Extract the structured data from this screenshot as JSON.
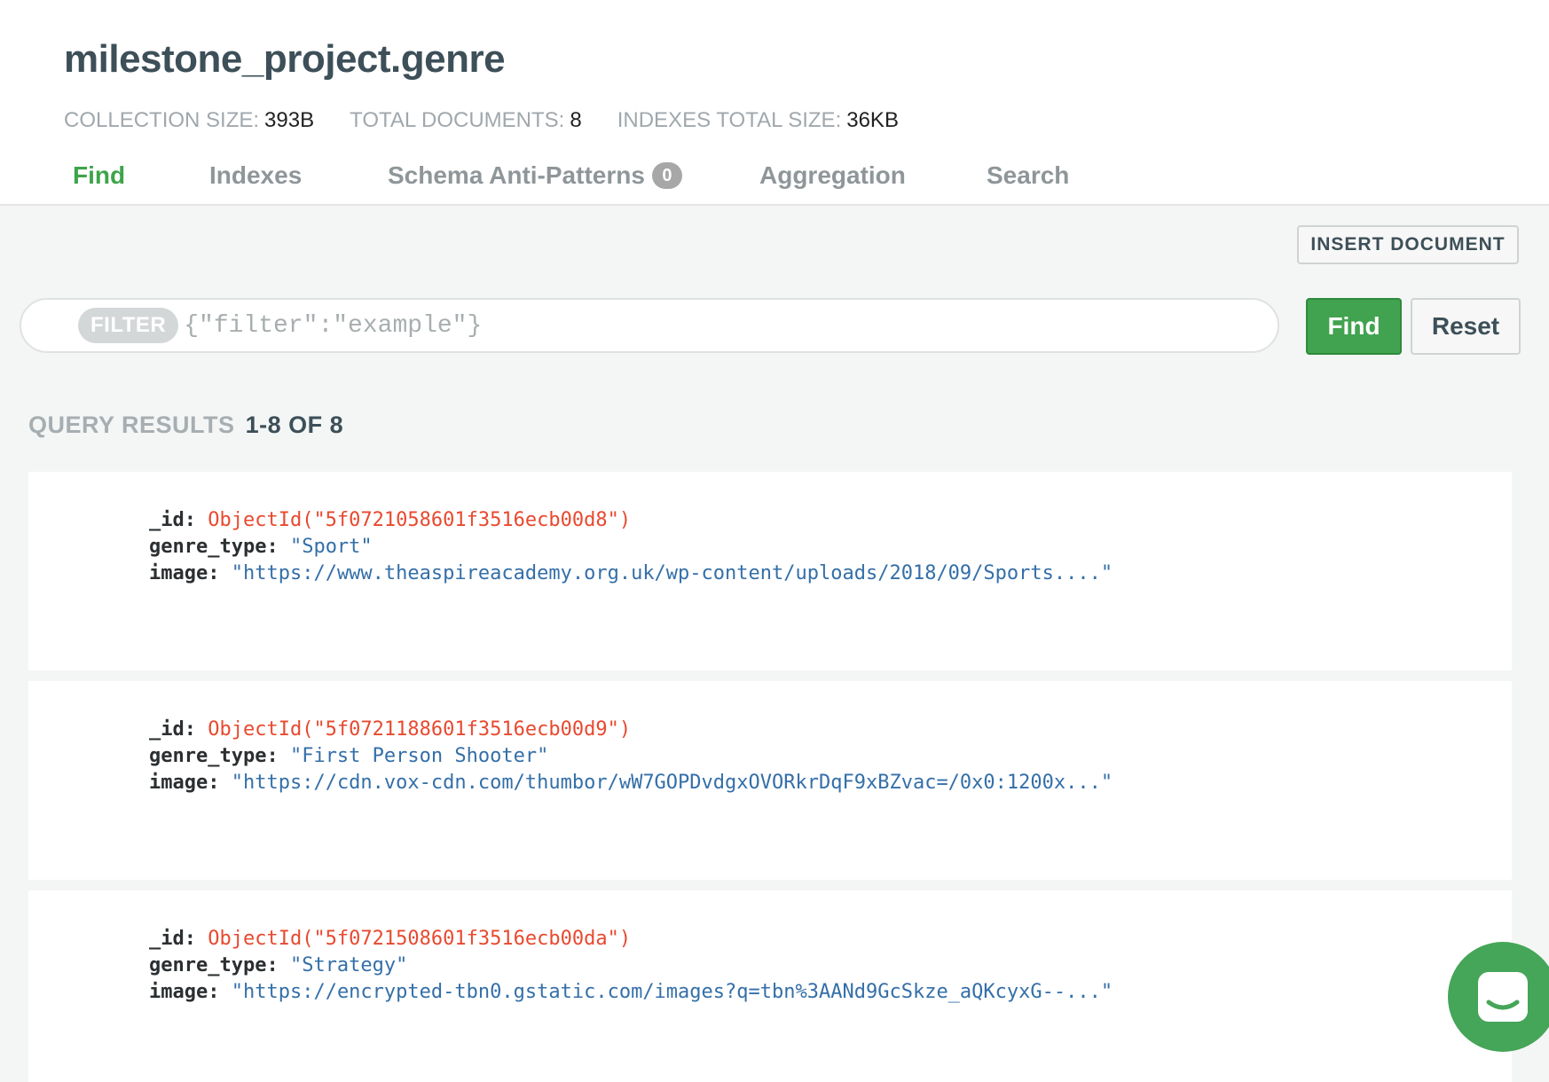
{
  "header": {
    "title": "milestone_project.genre",
    "stats": [
      {
        "label": "COLLECTION SIZE:",
        "value": "393B"
      },
      {
        "label": "TOTAL DOCUMENTS:",
        "value": "8"
      },
      {
        "label": "INDEXES TOTAL SIZE:",
        "value": "36KB"
      }
    ]
  },
  "tabs": [
    {
      "label": "Find",
      "active": true
    },
    {
      "label": "Indexes"
    },
    {
      "label": "Schema Anti-Patterns",
      "badge": "0"
    },
    {
      "label": "Aggregation"
    },
    {
      "label": "Search"
    }
  ],
  "toolbar": {
    "insert_label": "INSERT DOCUMENT",
    "filter_label": "FILTER",
    "filter_placeholder": "{\"filter\":\"example\"}",
    "find_label": "Find",
    "reset_label": "Reset"
  },
  "results": {
    "label": "QUERY RESULTS",
    "range": "1-8 OF 8"
  },
  "documents": [
    {
      "id_key": "_id:",
      "id_value": "ObjectId(\"5f0721058601f3516ecb00d8\")",
      "genre_key": "genre_type:",
      "genre_value": "\"Sport\"",
      "image_key": "image:",
      "image_value": "\"https://www.theaspireacademy.org.uk/wp-content/uploads/2018/09/Sports....\""
    },
    {
      "id_key": "_id:",
      "id_value": "ObjectId(\"5f0721188601f3516ecb00d9\")",
      "genre_key": "genre_type:",
      "genre_value": "\"First Person Shooter\"",
      "image_key": "image:",
      "image_value": "\"https://cdn.vox-cdn.com/thumbor/wW7GOPDvdgxOVORkrDqF9xBZvac=/0x0:1200x...\""
    },
    {
      "id_key": "_id:",
      "id_value": "ObjectId(\"5f0721508601f3516ecb00da\")",
      "genre_key": "genre_type:",
      "genre_value": "\"Strategy\"",
      "image_key": "image:",
      "image_value": "\"https://encrypted-tbn0.gstatic.com/images?q=tbn%3AANd9GcSkze_aQKcyxG--...\""
    }
  ],
  "colors": {
    "accent_green": "#41a34f",
    "object_id": "#e8492f",
    "string_value": "#346fa8"
  },
  "icons": {
    "chat": "chat-bubble-icon"
  }
}
